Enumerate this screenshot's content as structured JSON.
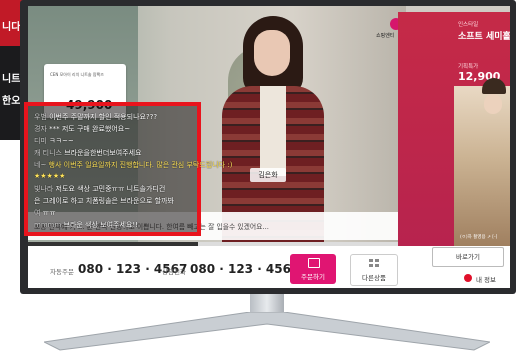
{
  "background_tv": {
    "lines": [
      "니다",
      "니트을",
      "한오르"
    ]
  },
  "broadcaster": {
    "logo_text": "쇼핑엔티"
  },
  "product_card": {
    "title": "CEN 모아이 리치 니트솔 팜팩즈",
    "price": "49,900"
  },
  "host": {
    "name": "김은화"
  },
  "caption": "보통 안쪽에 기 ... 폰 안쪽 단정하고 이쁩니다. 한여름 빼고는 잘 입을수 있겠어요...",
  "progress": 0.45,
  "next_product": {
    "subtitle": "인스타일",
    "title": "소프트 세미홀가니트",
    "price_label": "기획특가",
    "price": "12,900",
    "caption": "(ㅇ)하 촬영용 ↗ [-]"
  },
  "chat": {
    "lines": [
      {
        "user": "우범",
        "text": "이번주 주말까지 할인 적용되나요???"
      },
      {
        "user": "경자 ",
        "text": "*** 저도 구매 완료했어요~"
      },
      {
        "user": "디미",
        "text": "ㅋㅋ~~"
      },
      {
        "user": "캐 티니스",
        "text": "브라운을한번더보여주세요"
      },
      {
        "user": "네~",
        "text": "행사 이번주 일요일까지 진행합니다. 많은 관심 부탁드립니다 :)",
        "highlight": true
      },
      {
        "user": "",
        "text": "★★★★★",
        "highlight": true
      },
      {
        "user": "빛나라",
        "text": "저도요 색상 고민중ㅠㅠ 니트솔가디건"
      },
      {
        "user": "",
        "text": "은 그레이로 하고 치폼링솔은 브라운으로 할까봐"
      },
      {
        "user": "여",
        "text": "ㅠㅠ"
      },
      {
        "user": "mmmm",
        "text": "브라운 색상 보여주세요!!"
      }
    ]
  },
  "bottom_bar": {
    "auto_order_label": "자동주문",
    "auto_order_number": "080 · 123 · 4567",
    "consult_label": "상담전화",
    "consult_number": "080 · 123 · 4568",
    "order_button": "주문하기",
    "other_products_button": "다른상품",
    "buy_button": "바로가기",
    "my_info": "내 정보"
  },
  "colors": {
    "accent": "#e01572",
    "highlight_box": "#e8141d",
    "panel": "#c52a47"
  }
}
